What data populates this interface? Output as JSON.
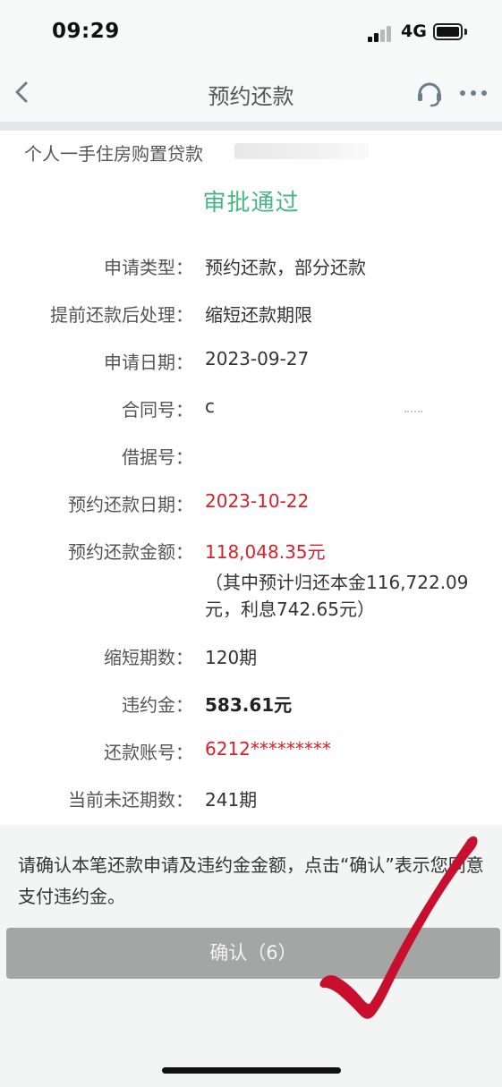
{
  "status_bar": {
    "time": "09:29",
    "network": "4G"
  },
  "nav": {
    "title": "预约还款",
    "back_icon": "chevron-left-icon",
    "service_icon": "headset-icon",
    "more_icon": "more-icon"
  },
  "loan": {
    "name": "个人一手住房购置贷款"
  },
  "approval_status": "审批通过",
  "details": {
    "application_type": {
      "label": "申请类型：",
      "value": "预约还款，部分还款"
    },
    "post_processing": {
      "label": "提前还款后处理：",
      "value": "缩短还款期限"
    },
    "application_date": {
      "label": "申请日期：",
      "value": "2023-09-27"
    },
    "contract_no": {
      "label": "合同号：",
      "value": "c"
    },
    "receipt_no": {
      "label": "借据号：",
      "value": ""
    },
    "repay_date": {
      "label": "预约还款日期：",
      "value": "2023-10-22"
    },
    "repay_amount": {
      "label": "预约还款金额：",
      "value": "118,048.35元",
      "note_line1": "（其中预计归还本金116,722.09",
      "note_line2": "元，利息742.65元）"
    },
    "shortened_periods": {
      "label": "缩短期数：",
      "value": "120期"
    },
    "penalty": {
      "label": "违约金：",
      "value": "583.61元"
    },
    "account": {
      "label": "还款账号：",
      "value": "6212*********"
    },
    "remaining_periods": {
      "label": "当前未还期数：",
      "value": "241期"
    }
  },
  "notice": {
    "text": "请确认本笔还款申请及违约金金额，点击“确认”表示您同意支付违约金。"
  },
  "confirm_button": {
    "label": "确认（6）"
  },
  "colors": {
    "approved_green": "#4bb487",
    "highlight_red": "#d8202a",
    "button_gray": "#a4a6a5",
    "checkmark_red": "#c8102e"
  }
}
